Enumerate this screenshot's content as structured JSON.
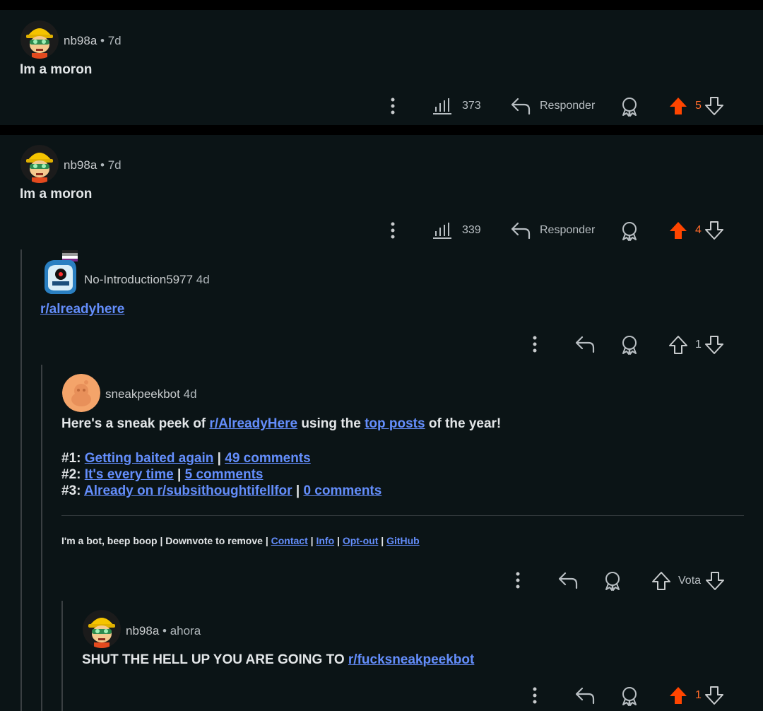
{
  "comments": [
    {
      "user": "nb98a",
      "time": "• 7d",
      "text": "Im a moron",
      "views": "373",
      "reply_label": "Responder",
      "score": "5"
    },
    {
      "user": "nb98a",
      "time": "• 7d",
      "text": "Im a moron",
      "views": "339",
      "reply_label": "Responder",
      "score": "4"
    },
    {
      "user": "No-Introduction5977",
      "time": "4d",
      "link": "r/alreadyhere",
      "score": "1"
    },
    {
      "user": "sneakpeekbot",
      "time": "4d",
      "intro_1": "Here's a sneak peek of",
      "intro_link": "r/AlreadyHere",
      "intro_2": "using the",
      "intro_link2": "top posts",
      "intro_3": "of the year!",
      "posts": [
        {
          "num": "#1:",
          "title": "Getting baited again",
          "sep": "|",
          "comments": "49 comments"
        },
        {
          "num": "#2:",
          "title": "It's every time",
          "sep": "|",
          "comments": "5 comments"
        },
        {
          "num": "#3:",
          "title": "Already on r/subsithoughtifellfor",
          "sep": "|",
          "comments": "0 comments"
        }
      ],
      "footer_text": "I'm a bot, beep boop | Downvote to remove |",
      "footer_links": [
        "Contact",
        "Info",
        "Opt-out",
        "GitHub"
      ],
      "footer_sep": "|",
      "vote_label": "Vota"
    },
    {
      "user": "nb98a",
      "time": "• ahora",
      "text_prefix": "SHUT THE HELL UP YOU ARE GOING TO",
      "text_link": "r/fucksneakpeekbot",
      "score": "1"
    }
  ],
  "colors": {
    "background": "#0b1416",
    "upvote_active": "#ff4500",
    "link": "#648efc",
    "text": "#e3e6e8"
  },
  "icons": [
    "more-icon",
    "views-icon",
    "reply-icon",
    "award-icon",
    "upvote-icon",
    "downvote-icon"
  ]
}
